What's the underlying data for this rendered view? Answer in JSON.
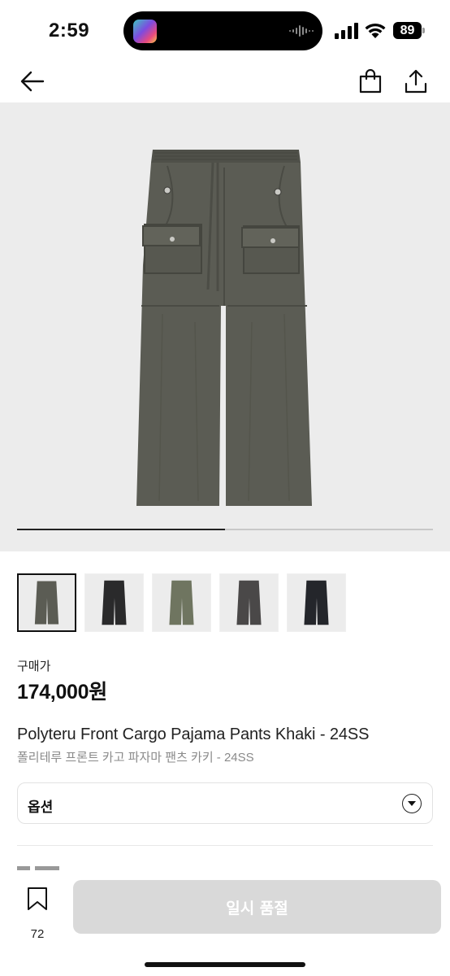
{
  "status_bar": {
    "time": "2:59",
    "battery": "89"
  },
  "nav": {
    "back_icon": "arrow-left-icon",
    "cart_icon": "shopping-bag-icon",
    "share_icon": "share-icon"
  },
  "gallery": {
    "progress": 0.5,
    "thumbnails": [
      {
        "color_name": "khaki-gray",
        "color": "#5b5c54",
        "selected": true
      },
      {
        "color_name": "black",
        "color": "#2a2a2b",
        "selected": false
      },
      {
        "color_name": "olive",
        "color": "#6f7560",
        "selected": false
      },
      {
        "color_name": "charcoal",
        "color": "#4a4848",
        "selected": false
      },
      {
        "color_name": "navy-black",
        "color": "#24262b",
        "selected": false
      }
    ]
  },
  "product": {
    "price_label": "구매가",
    "price": "174,000원",
    "name_en": "Polyteru Front Cargo Pajama Pants Khaki - 24SS",
    "name_ko": "폴리테루 프론트 카고 파자마 팬츠 카키 - 24SS"
  },
  "option": {
    "label": "옵션",
    "chevron_icon": "chevron-down-icon"
  },
  "bottom": {
    "bookmark_icon": "bookmark-icon",
    "bookmark_count": "72",
    "buy_label": "일시 품절"
  },
  "colors": {
    "hero_bg": "#ececec",
    "pants": "#5b5c54",
    "button_disabled": "#d9d9d9"
  }
}
